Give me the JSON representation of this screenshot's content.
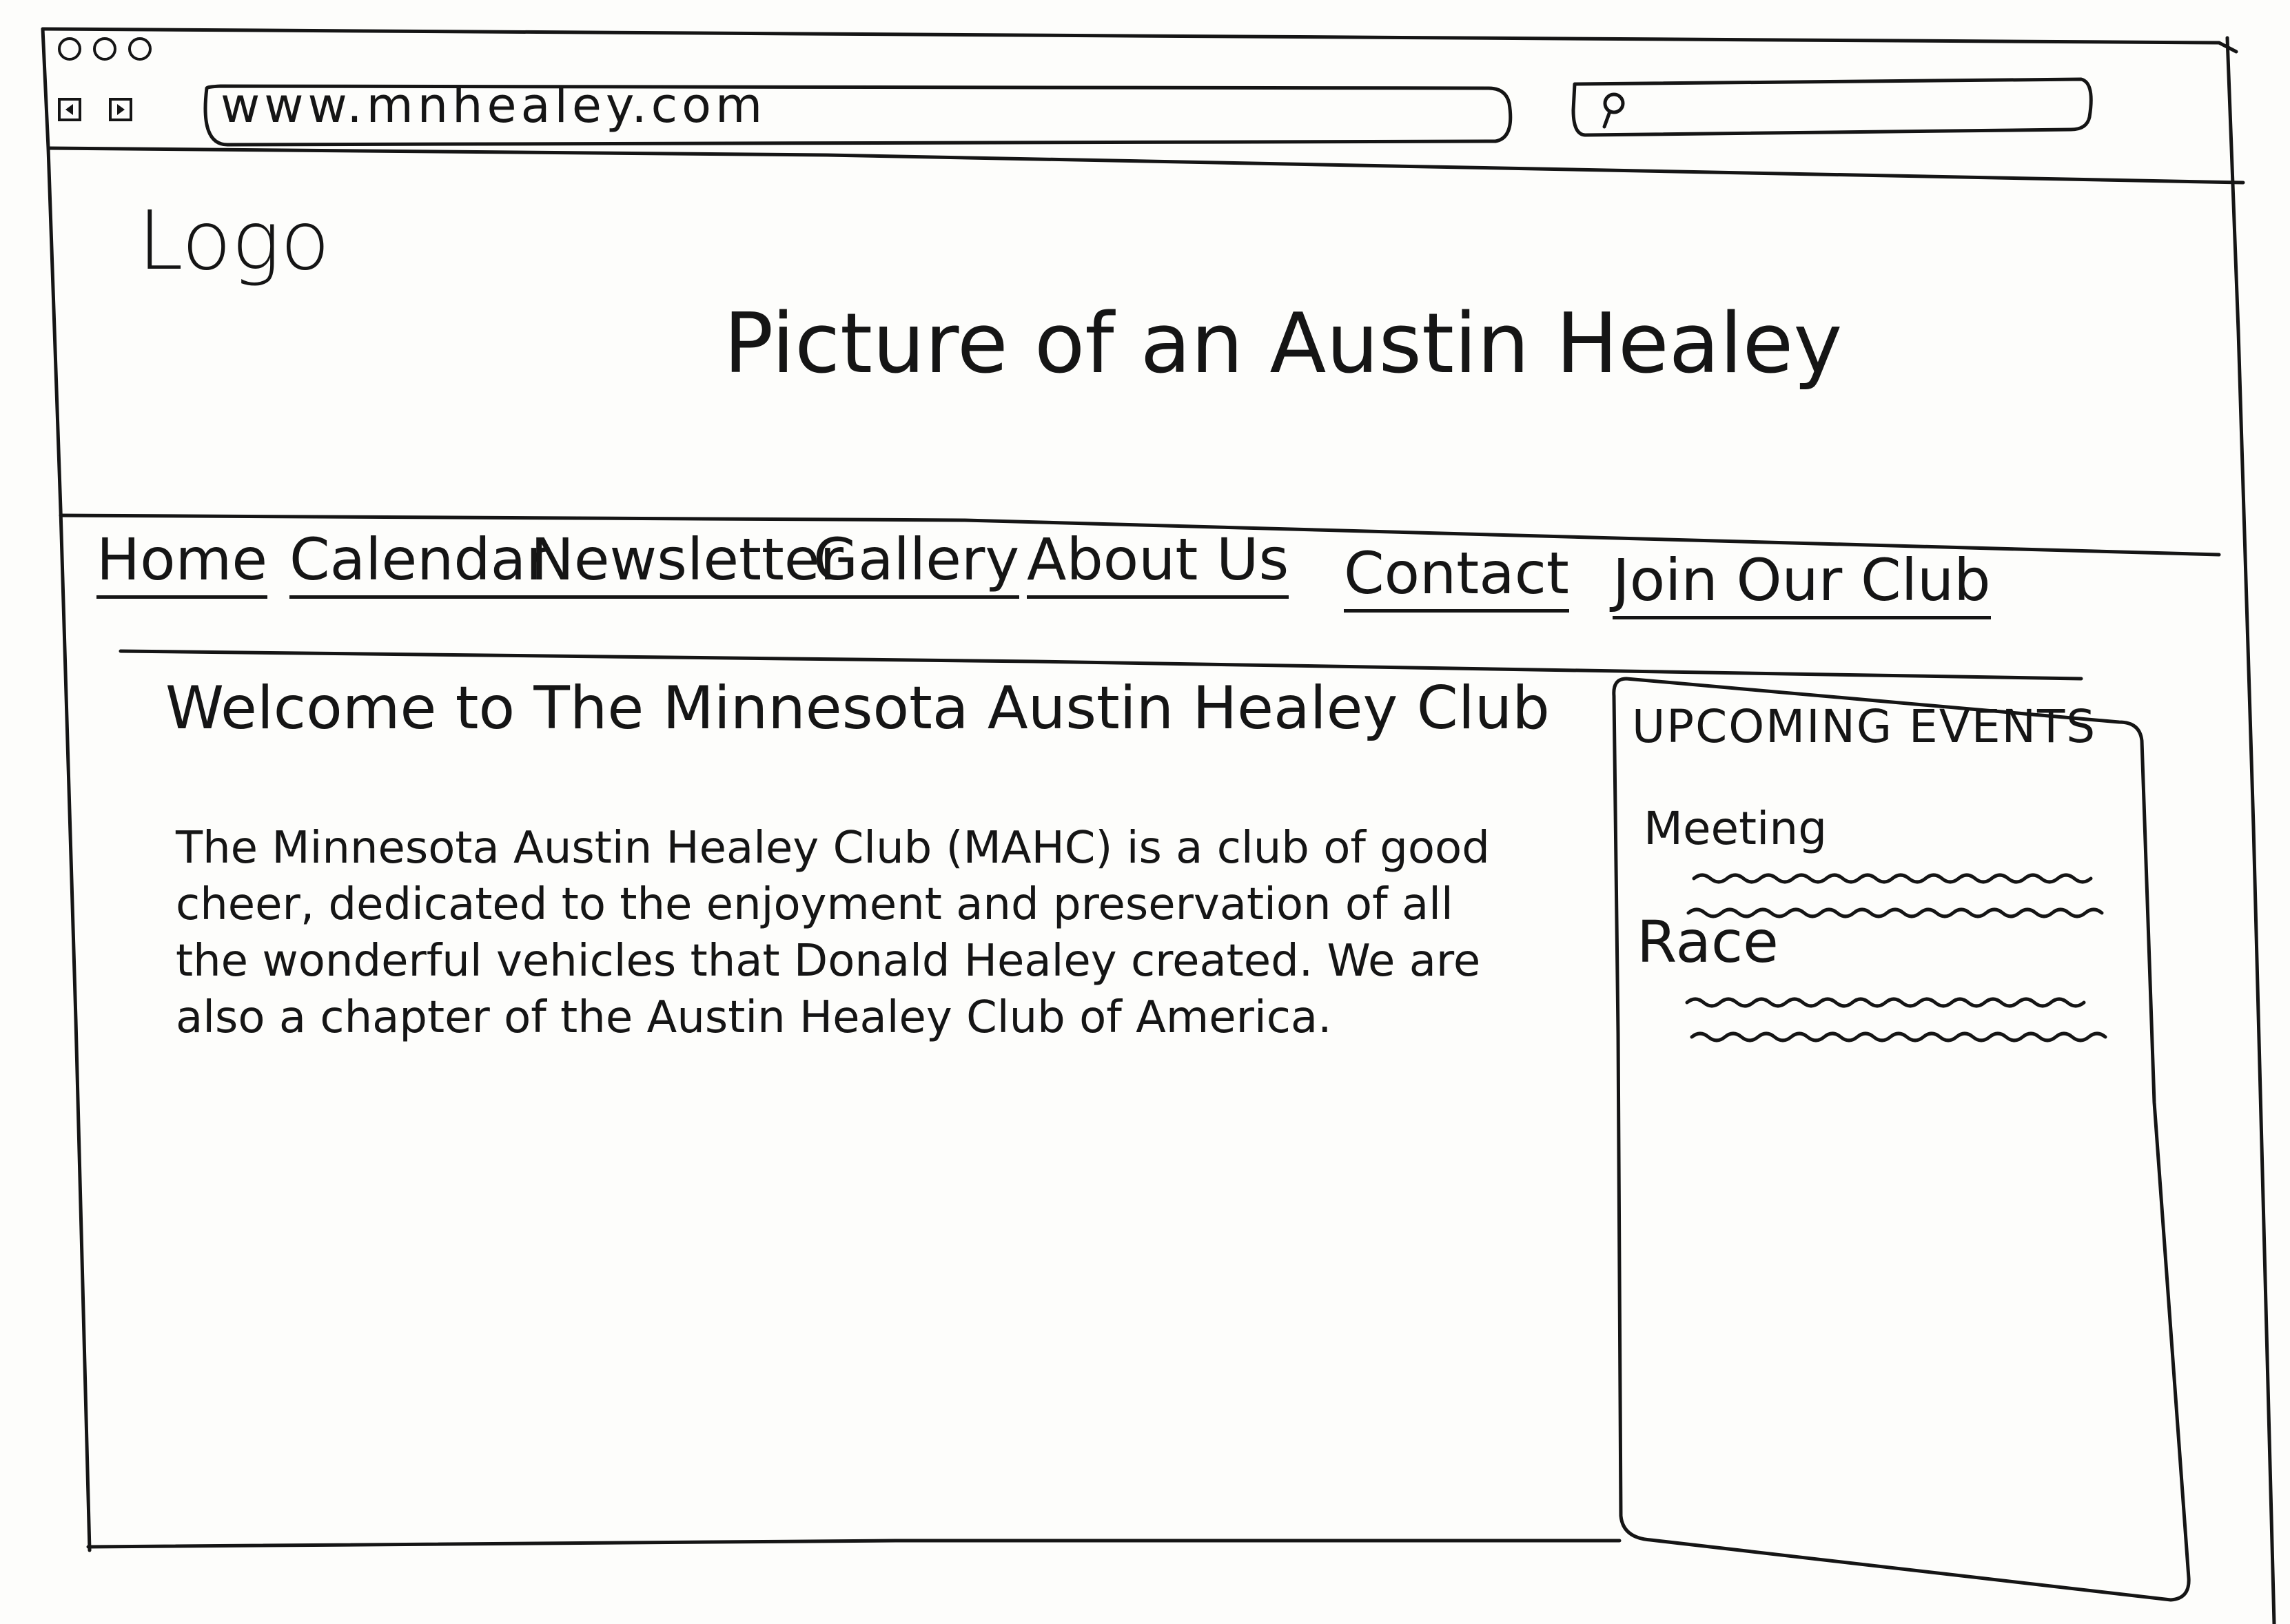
{
  "browser": {
    "url": "www.mnhealey.com",
    "search_placeholder": ""
  },
  "header": {
    "logo_text": "Logo",
    "hero_text": "Picture of an Austin Healey"
  },
  "nav": {
    "items": [
      {
        "label": "Home"
      },
      {
        "label": "Calendar"
      },
      {
        "label": "Newsletter"
      },
      {
        "label": "Gallery"
      },
      {
        "label": "About Us"
      },
      {
        "label": "Contact"
      },
      {
        "label": "Join Our Club"
      }
    ]
  },
  "main": {
    "heading": "Welcome to The Minnesota Austin Healey Club",
    "intro": "The Minnesota Austin Healey Club (MAHC) is a club of good cheer, dedicated to the enjoyment and preservation of all the wonderful vehicles that Donald Healey created. We are also a chapter of the Austin Healey Club of America."
  },
  "sidebar": {
    "title": "UPCOMING EVENTS",
    "events": [
      {
        "label": "Meeting"
      },
      {
        "label": "Race"
      }
    ]
  }
}
